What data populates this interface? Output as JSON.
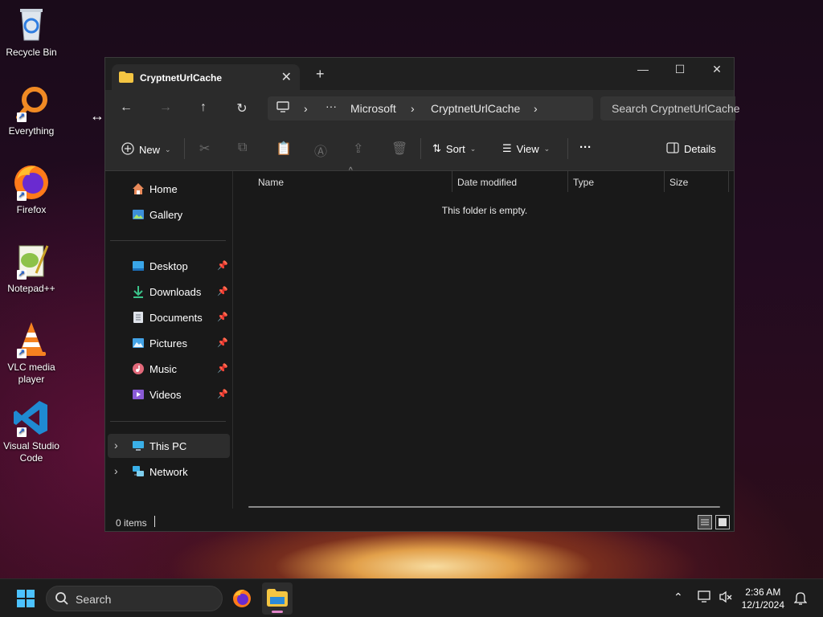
{
  "desktop": {
    "icons": [
      {
        "label": "Recycle Bin"
      },
      {
        "label": "Everything"
      },
      {
        "label": "Firefox"
      },
      {
        "label": "Notepad++"
      },
      {
        "label": "VLC media player"
      },
      {
        "label": "Visual Studio Code"
      }
    ]
  },
  "window": {
    "tab_title": "CryptnetUrlCache",
    "address": {
      "overflow": "···",
      "crumbs": [
        "Microsoft",
        "CryptnetUrlCache"
      ]
    },
    "search_placeholder": "Search CryptnetUrlCache",
    "toolbar": {
      "new_label": "New",
      "sort_label": "Sort",
      "view_label": "View",
      "more_label": "···",
      "details_label": "Details"
    },
    "sidebar": {
      "quick": [
        {
          "label": "Home"
        },
        {
          "label": "Gallery"
        }
      ],
      "pinned": [
        {
          "label": "Desktop"
        },
        {
          "label": "Downloads"
        },
        {
          "label": "Documents"
        },
        {
          "label": "Pictures"
        },
        {
          "label": "Music"
        },
        {
          "label": "Videos"
        }
      ],
      "devices": [
        {
          "label": "This PC"
        },
        {
          "label": "Network"
        }
      ]
    },
    "columns": [
      "Name",
      "Date modified",
      "Type",
      "Size"
    ],
    "empty_message": "This folder is empty.",
    "status": {
      "items": "0 items"
    }
  },
  "taskbar": {
    "search_placeholder": "Search",
    "time": "2:36 AM",
    "date": "12/1/2024"
  },
  "colors": {
    "accent": "#4cc2ff",
    "folder": "#f4c542"
  }
}
